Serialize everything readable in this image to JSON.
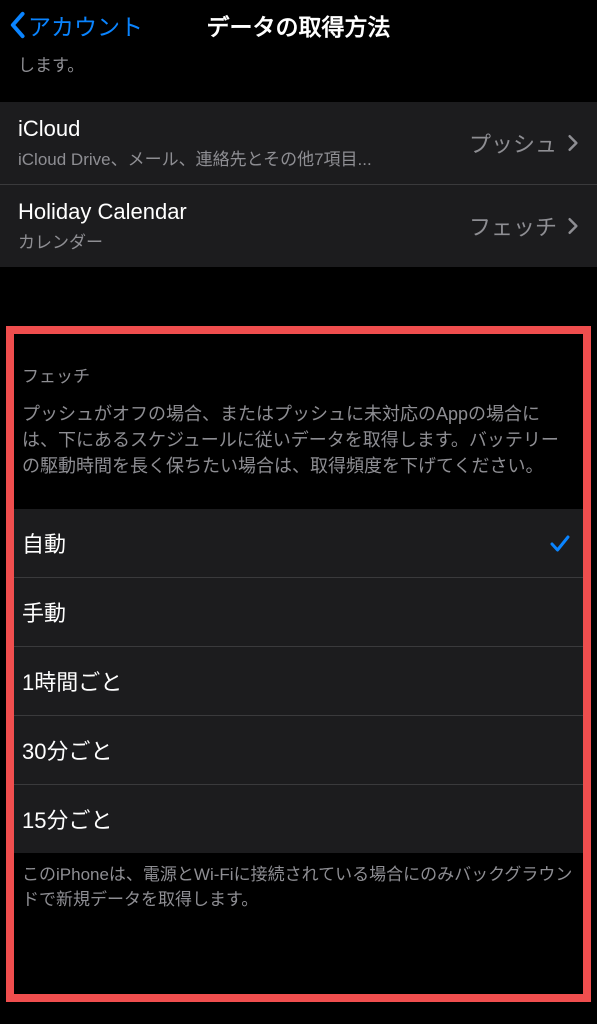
{
  "nav": {
    "back_label": "アカウント",
    "title": "データの取得方法"
  },
  "push_footer_fragment": "します。",
  "accounts": [
    {
      "title": "iCloud",
      "subtitle": "iCloud Drive、メール、連絡先とその他7項目...",
      "value": "プッシュ"
    },
    {
      "title": "Holiday Calendar",
      "subtitle": "カレンダー",
      "value": "フェッチ"
    }
  ],
  "fetch": {
    "header": "フェッチ",
    "description": "プッシュがオフの場合、またはプッシュに未対応のAppの場合には、下にあるスケジュールに従いデータを取得します。バッテリーの駆動時間を長く保ちたい場合は、取得頻度を下げてください。",
    "options": [
      {
        "label": "自動",
        "selected": true
      },
      {
        "label": "手動",
        "selected": false
      },
      {
        "label": "1時間ごと",
        "selected": false
      },
      {
        "label": "30分ごと",
        "selected": false
      },
      {
        "label": "15分ごと",
        "selected": false
      }
    ],
    "footer": "このiPhoneは、電源とWi-Fiに接続されている場合にのみバックグラウンドで新規データを取得します。"
  },
  "colors": {
    "accent": "#0a84ff",
    "highlight_border": "#ef4e4e"
  }
}
